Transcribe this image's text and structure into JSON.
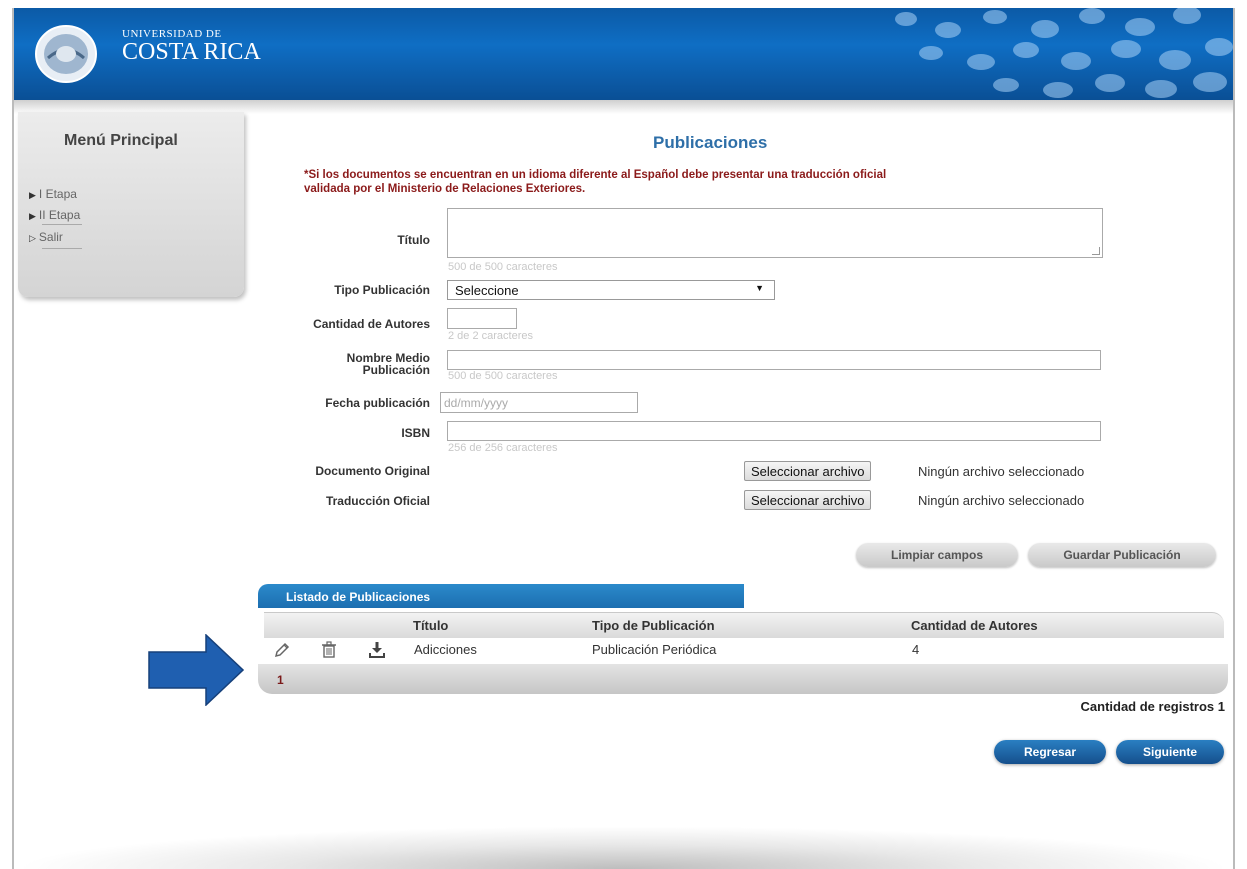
{
  "header": {
    "brand_top": "UNIVERSIDAD DE",
    "brand_main": "COSTA RICA"
  },
  "sidebar": {
    "title": "Menú Principal",
    "items": [
      {
        "label": "I Etapa"
      },
      {
        "label": "II Etapa"
      },
      {
        "label": "Salir"
      }
    ]
  },
  "main": {
    "title": "Publicaciones",
    "notice_line1": "*Si los documentos se encuentran en un idioma diferente al Español debe presentar una traducción oficial",
    "notice_line2": "validada por el Ministerio de Relaciones Exteriores."
  },
  "form": {
    "titulo_label": "Título",
    "titulo_counter": "500 de 500 caracteres",
    "tipo_label": "Tipo Publicación",
    "tipo_value": "Seleccione",
    "autores_label": "Cantidad de Autores",
    "autores_counter": "2 de 2 caracteres",
    "medio_label_1": "Nombre Medio",
    "medio_label_2": "Publicación",
    "medio_counter": "500 de 500 caracteres",
    "fecha_label": "Fecha publicación",
    "fecha_placeholder": "dd/mm/yyyy",
    "isbn_label": "ISBN",
    "isbn_counter": "256 de 256 caracteres",
    "doc_label": "Documento Original",
    "trad_label": "Traducción Oficial",
    "file_button": "Seleccionar archivo",
    "file_status": "Ningún archivo seleccionado",
    "clear_button": "Limpiar campos",
    "save_button": "Guardar Publicación"
  },
  "list": {
    "tab_title": "Listado de Publicaciones",
    "columns": [
      "Título",
      "Tipo de Publicación",
      "Cantidad de Autores"
    ],
    "rows": [
      {
        "titulo": "Adicciones",
        "tipo": "Publicación Periódica",
        "autores": "4"
      }
    ],
    "page": "1",
    "count_text": "Cantidad de registros 1"
  },
  "nav": {
    "back": "Regresar",
    "next": "Siguiente"
  },
  "colors": {
    "header_blue": "#0f6ec4",
    "title_blue": "#2e6fa8",
    "notice_red": "#8b1a1a",
    "arrow_blue": "#1f5fb0"
  }
}
